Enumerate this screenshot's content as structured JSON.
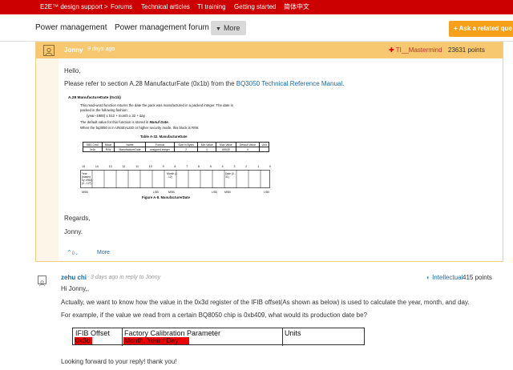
{
  "topnav": [
    "E2E™ design support >",
    "Forums",
    "Technical articles",
    "TI training",
    "Getting started",
    "简体中文"
  ],
  "breadcrumb": {
    "item1": "Power management",
    "sep": "›",
    "item2": "Power management forum",
    "more": "More",
    "ask": "+ Ask a related que"
  },
  "answer": {
    "author": "Jonny",
    "time": "9 days ago",
    "role": "TI__Mastermind",
    "points": "23631 points",
    "greeting": "Hello,",
    "body_pre": "Please refer to section A.28 ManufacturFate (0x1b) from the ",
    "body_link": "BQ3050 Technical Reference Manual",
    "body_post": ".",
    "regards": "Regards,",
    "sign": "Jonny.",
    "more": "More",
    "votes": "0"
  },
  "doc": {
    "heading": "A.28   ManufactureDate (0x1b)",
    "line1": "This read-word function returns the date the pack was manufactured in a packed integer. The date is",
    "line2": "packed in the following fashion:",
    "line3": "(year−1980) x 512 + month x 32 + day",
    "line4_pre": "The default value for this function is stored in ",
    "line4_bold": "Manuf Date",
    "line4_post": ".",
    "line5": "When the bq3050 is in UNSEALED or higher security mode, this block is R/W.",
    "table_title": "Table A-32. ManufactureDate",
    "table_headers": [
      "SBS Cmd.",
      "Mode",
      "Name",
      "Format",
      "Size in Bytes",
      "Min Value",
      "Max Value",
      "Default Value",
      "Unit"
    ],
    "table_row": [
      "0x1b",
      "R/W",
      "ManufacturerDate",
      "unsigned integer",
      "2",
      "0",
      "65535",
      "0",
      ""
    ],
    "bits": [
      "15",
      "14",
      "13",
      "12",
      "11",
      "10",
      "9",
      "8",
      "7",
      "6",
      "5",
      "4",
      "3",
      "2",
      "1",
      "0"
    ],
    "field_year": "Year (biased by 1980) (0 - 127)",
    "field_month": "Month (1 - 12)",
    "field_date": "Date (0 - 31)",
    "msb": "MSB",
    "lsb": "LSB",
    "figure": "Figure A-8. ManufacturerDate"
  },
  "reply": {
    "author": "zehu chi",
    "meta_time": "3 days ago",
    "meta_in": " in reply to ",
    "meta_to": "Jonny",
    "role": "Intellectual",
    "points": "415 points",
    "line1": "Hi Jonny,,",
    "line2": "Actually, we want to know how the value in the 0x3d register of the IFIB offset(As shown as below) is used to calculate the year, month, and day.",
    "line3": "For example, if the value we read from a certain BQ8050 chip is 0xb409, what would its production date be?",
    "table_h1": "IFIB Offset",
    "table_h2": "Factory Calibration Parameter",
    "table_h3": "Units",
    "table_v1": "0x3d",
    "table_v2": "Month, Year / Day",
    "closing": "Looking forward to your reply! thank you!"
  }
}
